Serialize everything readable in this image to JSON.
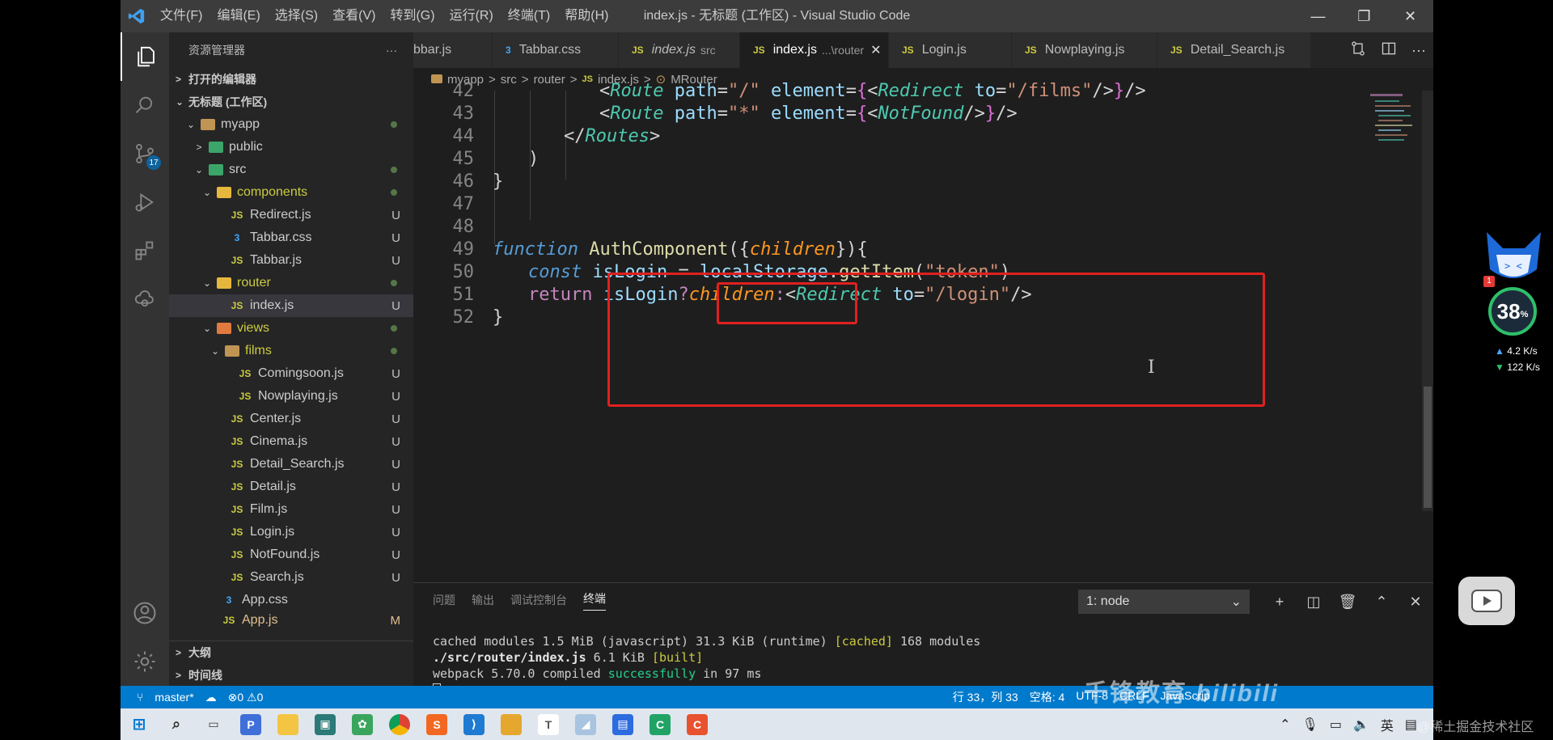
{
  "window": {
    "title": "index.js - 无标题 (工作区) - Visual Studio Code",
    "menu": [
      "文件(F)",
      "编辑(E)",
      "选择(S)",
      "查看(V)",
      "转到(G)",
      "运行(R)",
      "终端(T)",
      "帮助(H)"
    ]
  },
  "activity": {
    "scm_badge": "17"
  },
  "sidebar": {
    "title": "资源管理器",
    "open_editors": "打开的编辑器",
    "workspace": "无标题 (工作区)",
    "outline": "大纲",
    "timeline": "时间线",
    "tree": [
      {
        "label": "myapp",
        "status": ""
      },
      {
        "label": "public",
        "status": ""
      },
      {
        "label": "src",
        "status": ""
      },
      {
        "label": "components",
        "status": ""
      },
      {
        "label": "Redirect.js",
        "status": "U"
      },
      {
        "label": "Tabbar.css",
        "status": "U"
      },
      {
        "label": "Tabbar.js",
        "status": "U"
      },
      {
        "label": "router",
        "status": ""
      },
      {
        "label": "index.js",
        "status": "U"
      },
      {
        "label": "views",
        "status": ""
      },
      {
        "label": "films",
        "status": ""
      },
      {
        "label": "Comingsoon.js",
        "status": "U"
      },
      {
        "label": "Nowplaying.js",
        "status": "U"
      },
      {
        "label": "Center.js",
        "status": "U"
      },
      {
        "label": "Cinema.js",
        "status": "U"
      },
      {
        "label": "Detail_Search.js",
        "status": "U"
      },
      {
        "label": "Detail.js",
        "status": "U"
      },
      {
        "label": "Film.js",
        "status": "U"
      },
      {
        "label": "Login.js",
        "status": "U"
      },
      {
        "label": "NotFound.js",
        "status": "U"
      },
      {
        "label": "Search.js",
        "status": "U"
      },
      {
        "label": "App.css",
        "status": ""
      },
      {
        "label": "App.js",
        "status": "M"
      }
    ]
  },
  "tabs": [
    {
      "label": "bbar.js",
      "sub": ""
    },
    {
      "label": "Tabbar.css",
      "sub": ""
    },
    {
      "label": "index.js",
      "sub": "src"
    },
    {
      "label": "index.js",
      "sub": "...\\router"
    },
    {
      "label": "Login.js",
      "sub": ""
    },
    {
      "label": "Nowplaying.js",
      "sub": ""
    },
    {
      "label": "Detail_Search.js",
      "sub": ""
    }
  ],
  "breadcrumb": [
    "myapp",
    "src",
    "router",
    "index.js",
    "MRouter"
  ],
  "editor": {
    "line_numbers": [
      "42",
      "43",
      "44",
      "45",
      "46",
      "47",
      "48",
      "49",
      "50",
      "51",
      "52"
    ],
    "code": {
      "l42": {
        "a": "<",
        "b": "Route",
        "c": " path",
        "d": "=",
        "e": "\"/\"",
        "f": " element",
        "g": "=",
        "h": "{",
        "i": "<",
        "j": "Redirect",
        "k": " to",
        "l": "=",
        "m": "\"/films\"",
        "n": "/>",
        "o": "}",
        "p": "/>"
      },
      "l43": {
        "a": "<",
        "b": "Route",
        "c": " path",
        "d": "=",
        "e": "\"*\"",
        "f": " element",
        "g": "=",
        "h": "{",
        "i": "<",
        "j": "NotFound",
        "k": "/>",
        "l": "}",
        "m": "/>"
      },
      "l44": {
        "a": "</",
        "b": "Routes",
        "c": ">"
      },
      "l45": ")",
      "l46": "}",
      "l49": {
        "a": "function",
        "b": "AuthComponent",
        "c": "({",
        "d": "children",
        "e": "}){"
      },
      "l50": {
        "a": "const",
        "b": " isLogin",
        "c": " = ",
        "d": "localStorage",
        "e": ".",
        "f": "getItem",
        "g": "(",
        "h": "\"token\"",
        "i": ")"
      },
      "l51": {
        "a": "return",
        "b": " isLogin",
        "c": "?",
        "d": "children",
        "e": ":",
        "f": "<",
        "g": "Redirect",
        "h": " to",
        "i": "=",
        "j": "\"/login\"",
        "k": "/>"
      },
      "l52": "}"
    },
    "cursor_glyph": "I"
  },
  "panel": {
    "tabs": [
      "问题",
      "输出",
      "调试控制台",
      "终端"
    ],
    "terminal_select": "1: node",
    "lines": {
      "l1a": "cached modules 1.5 MiB (javascript) 31.3 KiB (runtime) ",
      "l1b": "[cached]",
      "l1c": " 168 modules",
      "l2a": "./src/router/index.js",
      "l2b": " 6.1 KiB ",
      "l2c": "[built]",
      "l3a": "webpack 5.70.0 compiled ",
      "l3b": "successfully",
      "l3c": " in 97 ms"
    }
  },
  "status": {
    "branch": "master*",
    "problems": "⊗0 ⚠0",
    "position": "行 33，列 33",
    "spaces": "空格: 4",
    "encoding": "UTF-8",
    "eol": "CRLF",
    "language": "JavaScrip"
  },
  "taskbar": {
    "ime": "英"
  },
  "overlay": {
    "watermark": "千锋教育",
    "site": "@稀土掘金技术社区",
    "gauge": "38",
    "gauge_unit": "%",
    "up_speed": "4.2 K/s",
    "down_speed": "122 K/s",
    "notify": "1"
  }
}
